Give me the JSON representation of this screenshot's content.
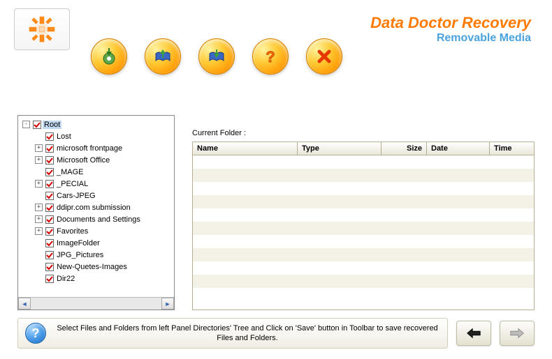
{
  "header": {
    "title_main": "Data Doctor Recovery",
    "title_sub": "Removable Media"
  },
  "toolbar": {
    "buttons": [
      {
        "name": "load-button",
        "icon": "disc-down"
      },
      {
        "name": "open-button",
        "icon": "book-up"
      },
      {
        "name": "save-button",
        "icon": "book-down"
      },
      {
        "name": "help-button",
        "icon": "question"
      },
      {
        "name": "close-button",
        "icon": "cross"
      }
    ]
  },
  "tree": {
    "nodes": [
      {
        "indent": 0,
        "expander": "-",
        "checked": true,
        "label": "Root",
        "selected": true
      },
      {
        "indent": 1,
        "expander": "",
        "checked": true,
        "label": "Lost"
      },
      {
        "indent": 1,
        "expander": "+",
        "checked": true,
        "label": "microsoft frontpage"
      },
      {
        "indent": 1,
        "expander": "+",
        "checked": true,
        "label": "Microsoft Office"
      },
      {
        "indent": 1,
        "expander": "",
        "checked": true,
        "label": "_MAGE"
      },
      {
        "indent": 1,
        "expander": "+",
        "checked": true,
        "label": "_PECIAL"
      },
      {
        "indent": 1,
        "expander": "",
        "checked": true,
        "label": "Cars-JPEG"
      },
      {
        "indent": 1,
        "expander": "+",
        "checked": true,
        "label": "ddipr.com submission"
      },
      {
        "indent": 1,
        "expander": "+",
        "checked": true,
        "label": "Documents and Settings"
      },
      {
        "indent": 1,
        "expander": "+",
        "checked": true,
        "label": "Favorites"
      },
      {
        "indent": 1,
        "expander": "",
        "checked": true,
        "label": "ImageFolder"
      },
      {
        "indent": 1,
        "expander": "",
        "checked": true,
        "label": "JPG_Pictures"
      },
      {
        "indent": 1,
        "expander": "",
        "checked": true,
        "label": "New-Quetes-Images"
      },
      {
        "indent": 1,
        "expander": "",
        "checked": true,
        "label": "Dir22"
      }
    ]
  },
  "main": {
    "current_folder_label": "Current Folder  :",
    "columns": {
      "name": "Name",
      "type": "Type",
      "size": "Size",
      "date": "Date",
      "time": "Time"
    },
    "rows": []
  },
  "footer": {
    "hint": "Select Files and Folders from left Panel Directories' Tree and Click on 'Save' button in Toolbar to save recovered Files and Folders.",
    "help_glyph": "?"
  }
}
